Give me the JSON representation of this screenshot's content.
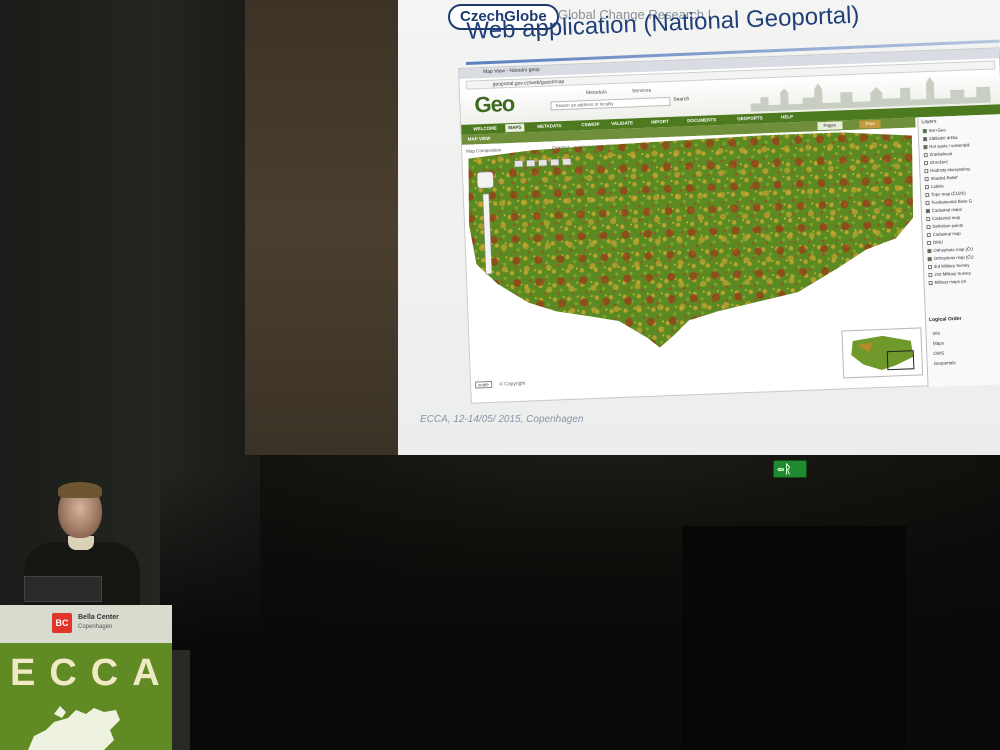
{
  "slide": {
    "logo": "CzechGlobe",
    "tagline": "Global Change Research I",
    "title": "Web application (National Geoportal)",
    "footer": "ECCA, 12-14/05/ 2015, Copenhagen"
  },
  "browser": {
    "tab": "Map View - Národní geop",
    "url": "geoportal.gov.cz/web/guest/map"
  },
  "geoportal": {
    "logo": "Geo",
    "meta_label": "Metadata",
    "services_label": "Services",
    "search_placeholder": "Search an address or locality",
    "search_button": "Search",
    "nav": [
      "WELCOME",
      "MAPS",
      "METADATA",
      "CSW/OP",
      "VALIDATE",
      "IMPORT",
      "DOCUMENTS",
      "GEOPORTS",
      "HELP"
    ],
    "active_nav": "MAPS",
    "sub_label": "MAP VIEW",
    "sub_buttons": [
      "Pages",
      "Print"
    ],
    "toolbar_text": "Map Composition",
    "overlay_text": "Overlays - overlays e-projekts",
    "copyright": "© Copyright",
    "scale_tag": "scale",
    "layers_title": "Layers",
    "layers": [
      {
        "label": "Sm+Geo",
        "on": true
      },
      {
        "label": "Základní držba",
        "on": true
      },
      {
        "label": "Hot spots / vulnerabil",
        "on": true
      },
      {
        "label": "Zranitelnost",
        "on": false
      },
      {
        "label": "Ohrožení",
        "on": false
      },
      {
        "label": "Hodnoty ekosystému",
        "on": false
      },
      {
        "label": "Shaded Relief",
        "on": false
      },
      {
        "label": "Labels",
        "on": false
      },
      {
        "label": "Topo map (ČÚZK)",
        "on": false
      },
      {
        "label": "Fundamental Base G",
        "on": false
      },
      {
        "label": "Cadastral maps",
        "on": true
      },
      {
        "label": "Cadastral map",
        "on": false
      },
      {
        "label": "Definition points",
        "on": false
      },
      {
        "label": "Cadastral map",
        "on": false
      },
      {
        "label": "DMU",
        "on": false
      },
      {
        "label": "Orthophoto map (ČÚ",
        "on": true
      },
      {
        "label": "Orthophoto map (ČÚ",
        "on": true
      },
      {
        "label": "3rd Military Survey",
        "on": false
      },
      {
        "label": "2nd Military Survey",
        "on": false
      },
      {
        "label": "Military maps (re",
        "on": false
      }
    ],
    "panel_tabs": "Logical Order",
    "panel_links": [
      "Info",
      "Maps",
      "OWS",
      "Geoportals"
    ]
  },
  "venue": {
    "exit_glyph": "⇦ᚱ",
    "podium_brand_icon": "BC",
    "podium_brand": "Bella Center",
    "podium_city": "Copenhagen",
    "podium_title": "ECCA"
  }
}
